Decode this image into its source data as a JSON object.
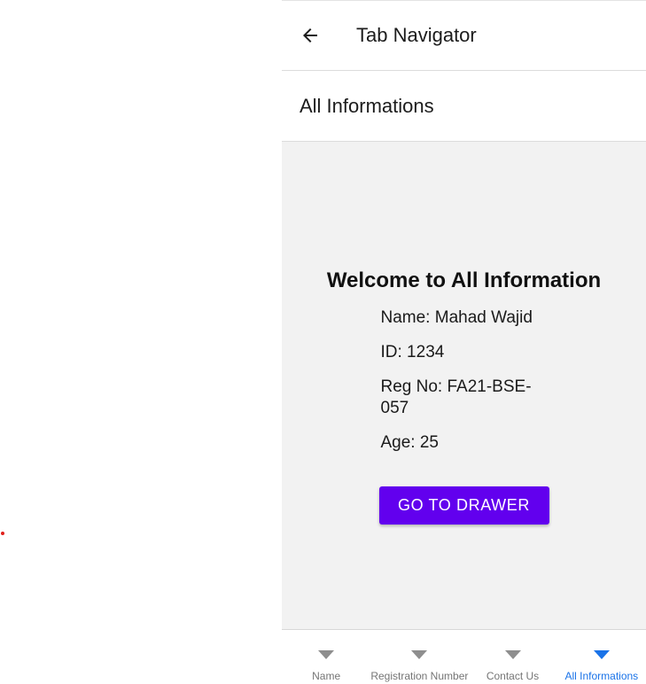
{
  "header": {
    "title": "Tab Navigator",
    "back_icon": "arrow-left-icon"
  },
  "subheader": {
    "title": "All Informations"
  },
  "content": {
    "welcome": "Welcome to All Information",
    "name_line": "Name: Mahad Wajid",
    "id_line": "ID: 1234",
    "reg_line": "Reg No: FA21-BSE-057",
    "age_line": "Age: 25",
    "button_label": "GO TO DRAWER"
  },
  "tabs": [
    {
      "label": "Name",
      "icon": "triangle-down-icon"
    },
    {
      "label": "Registration Number",
      "icon": "triangle-down-icon"
    },
    {
      "label": "Contact Us",
      "icon": "triangle-down-icon"
    },
    {
      "label": "All Informations",
      "icon": "triangle-down-icon",
      "active": true
    }
  ],
  "colors": {
    "accent": "#6200ee",
    "active_tab": "#1a73e8",
    "inactive_tab": "#757575",
    "content_bg": "#f2f2f2"
  }
}
